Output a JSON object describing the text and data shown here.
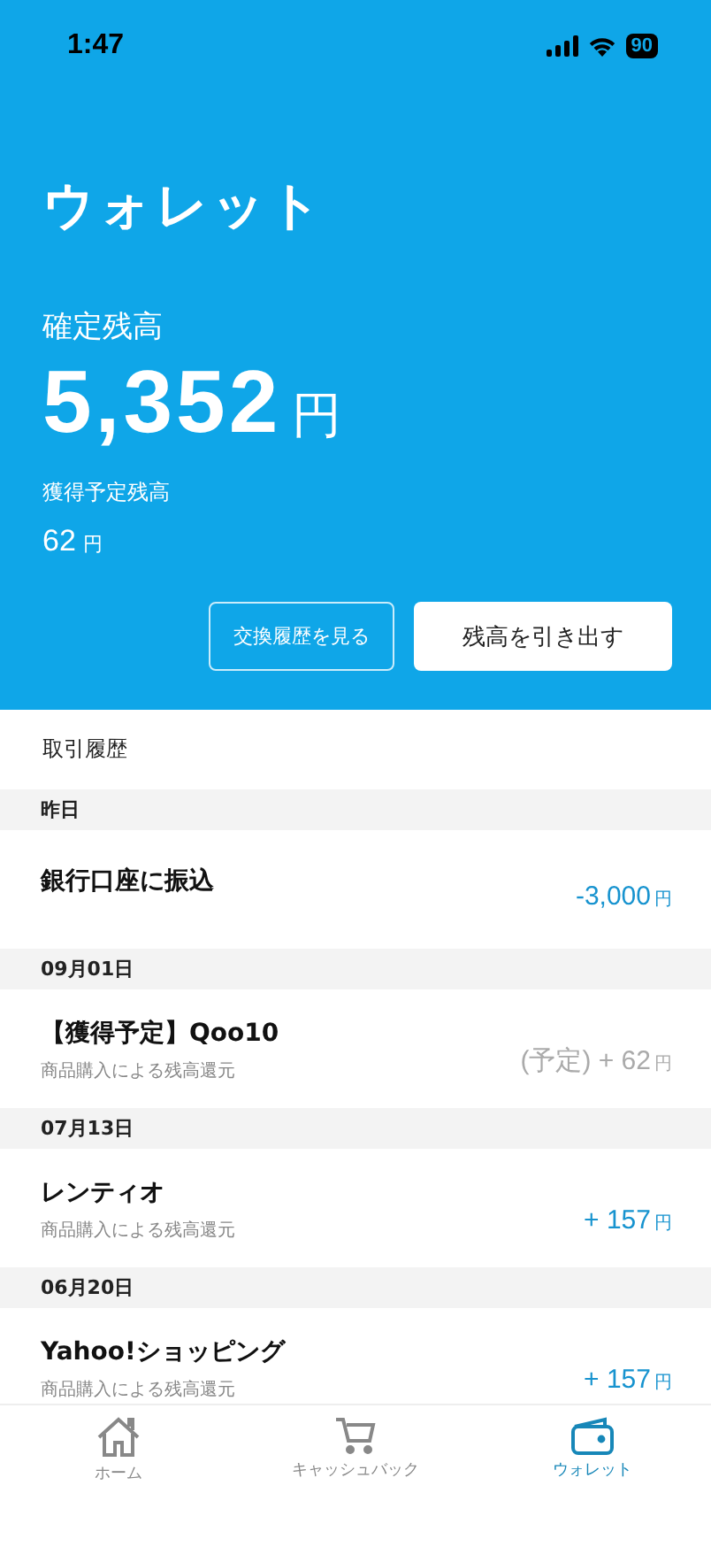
{
  "status_bar": {
    "time": "1:47",
    "battery": "90"
  },
  "header": {
    "title": "ウォレット",
    "balance_label": "確定残高",
    "balance": "5,352",
    "balance_unit": "円",
    "pending_label": "獲得予定残高",
    "pending": "62",
    "pending_unit": "円"
  },
  "buttons": [
    {
      "label": "交換履歴を見る",
      "kind": "outline"
    },
    {
      "label": "残高を引き出す",
      "kind": "solid"
    }
  ],
  "history_title": "取引履歴",
  "sections": [
    {
      "date": "昨日",
      "items": [
        {
          "title": "銀行口座に振込",
          "amount": "-3,000",
          "unit": "円",
          "pending": false
        }
      ]
    },
    {
      "date": "09月01日",
      "items": [
        {
          "title": "【獲得予定】Qoo10",
          "subtitle": "商品購入による残高還元",
          "amount": "(予定) + 62",
          "unit": "円",
          "pending": true
        }
      ]
    },
    {
      "date": "07月13日",
      "items": [
        {
          "title": "レンティオ",
          "subtitle": "商品購入による残高還元",
          "amount": "+ 157",
          "unit": "円",
          "pending": false
        }
      ]
    },
    {
      "date": "06月20日",
      "items": [
        {
          "title": "Yahoo!ショッピング",
          "subtitle": "商品購入による残高還元",
          "amount": "+ 157",
          "unit": "円",
          "pending": false
        }
      ]
    }
  ],
  "tab_bar": [
    {
      "label": "ホーム",
      "selected": false
    },
    {
      "label": "キャッシュバック",
      "selected": false
    },
    {
      "label": "ウォレット",
      "selected": true
    }
  ]
}
